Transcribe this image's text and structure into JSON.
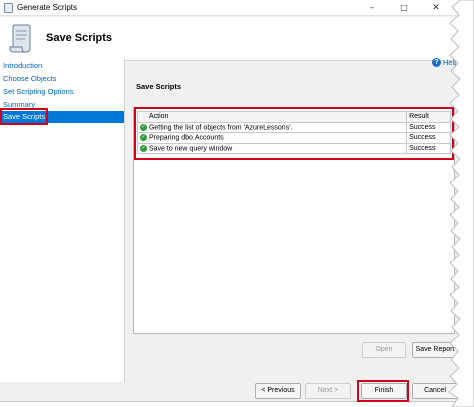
{
  "window": {
    "title": "Generate Scripts"
  },
  "header": {
    "title": "Save Scripts"
  },
  "nav": {
    "items": [
      {
        "label": "Introduction"
      },
      {
        "label": "Choose Objects"
      },
      {
        "label": "Set Scripting Options"
      },
      {
        "label": "Summary"
      },
      {
        "label": "Save Scripts",
        "selected": true
      }
    ]
  },
  "help": {
    "label": "Help"
  },
  "content": {
    "section_title": "Save Scripts",
    "grid": {
      "columns": [
        "Action",
        "Result"
      ],
      "rows": [
        {
          "action": "Getting the list of objects from 'AzureLessons'.",
          "result": "Success"
        },
        {
          "action": "Preparing dbo.Accounts",
          "result": "Success"
        },
        {
          "action": "Save to new query window",
          "result": "Success"
        }
      ]
    }
  },
  "buttons": {
    "open": "Open",
    "save_report": "Save Report",
    "previous": "< Previous",
    "next": "Next >",
    "finish": "Finish",
    "cancel": "Cancel"
  },
  "colors": {
    "highlight": "#d0021b",
    "selection": "#0078d7",
    "link": "#0066cc"
  },
  "icons": {
    "status": "success-check-icon",
    "help": "help-icon",
    "header": "script-scroll-icon"
  }
}
